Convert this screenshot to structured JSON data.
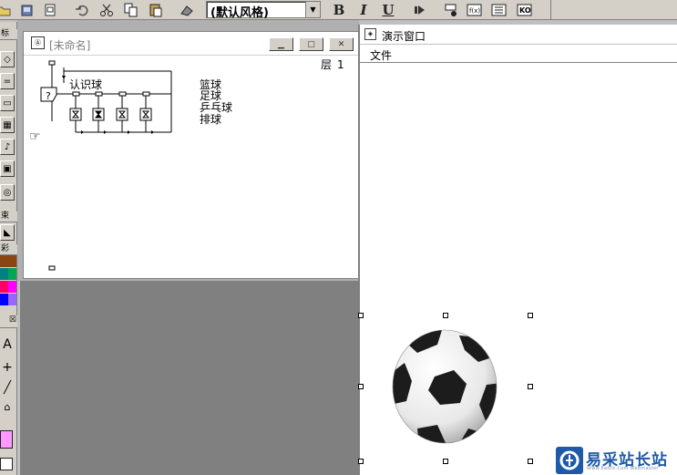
{
  "toolbar": {
    "style_value": "(默认风格)",
    "bold_label": "B",
    "italic_label": "I",
    "underline_label": "U"
  },
  "palette": {
    "caption_a": "标",
    "caption_end": "束",
    "caption_color": "彩",
    "text_tool": "A",
    "swatches": [
      "#8b4513",
      "#008080",
      "#00a651",
      "#ff00ff",
      "#ff0066",
      "#0000ff",
      "#9966ff",
      "#ff66cc"
    ],
    "fill_color": "#ff99ff"
  },
  "flow_window": {
    "title": "[未命名]",
    "layer_label": "层",
    "layer_number": "1",
    "interaction_label": "认识球",
    "responses": [
      "篮球",
      "足球",
      "乒乓球",
      "排球"
    ]
  },
  "presentation_window": {
    "title": "演示窗口",
    "menu_file": "文件"
  },
  "watermark": {
    "text": "易采站长站",
    "sub": "Www.Easck.Com Webmaster"
  }
}
